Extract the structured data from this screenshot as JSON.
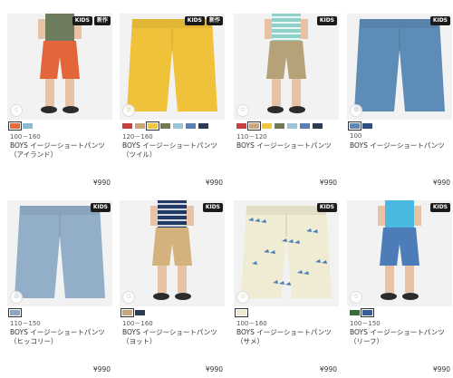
{
  "products": [
    {
      "tags": [
        "KIDS",
        "新作"
      ],
      "colors": [
        "#e46a3c",
        "#8cb9d4"
      ],
      "selected": 0,
      "size": "100－160",
      "name": "BOYS イージーショートパンツ（アイランド）",
      "price": "¥990",
      "pants_color": "#e2663a"
    },
    {
      "tags": [
        "KIDS",
        "新作"
      ],
      "colors": [
        "#c8403e",
        "#c9a77a",
        "#f1c63f",
        "#6f7a52",
        "#9ac4d8",
        "#5b7fb5",
        "#2e3b55"
      ],
      "selected": 2,
      "size": "120－160",
      "name": "BOYS イージーショートパンツ（ツイル）",
      "price": "¥990",
      "pants_color": "#f0c23a"
    },
    {
      "tags": [
        "KIDS"
      ],
      "colors": [
        "#c8403e",
        "#c9a77a",
        "#f1c63f",
        "#6f7a52",
        "#9ac4d8",
        "#5b7fb5",
        "#2e3b55"
      ],
      "selected": 1,
      "size": "110－120",
      "name": "BOYS イージーショートパンツ",
      "price": "¥990",
      "pants_color": "#b6a279"
    },
    {
      "tags": [
        "KIDS"
      ],
      "colors": [
        "#5e88b3",
        "#2f4f7a"
      ],
      "selected": 0,
      "size": "100",
      "name": "BOYS イージーショートパンツ",
      "price": "¥990",
      "pants_color": "#5d8cb6"
    },
    {
      "tags": [
        "KIDS"
      ],
      "colors": [
        "#8aa6c2"
      ],
      "selected": 0,
      "size": "110－150",
      "name": "BOYS イージーショートパンツ（ヒッコリー）",
      "price": "¥990",
      "pants_color": "#93aec9"
    },
    {
      "tags": [
        "KIDS"
      ],
      "colors": [
        "#c9a77a",
        "#2e3b55"
      ],
      "selected": 0,
      "size": "100－160",
      "name": "BOYS イージーショートパンツ（ヨット）",
      "price": "¥990",
      "pants_color": "#d3b27e"
    },
    {
      "tags": [
        "KIDS"
      ],
      "colors": [
        "#ece9d0"
      ],
      "selected": 0,
      "size": "100－160",
      "name": "BOYS イージーショートパンツ（サメ）",
      "price": "¥990",
      "pants_color": "#efecd3"
    },
    {
      "tags": [
        "KIDS"
      ],
      "colors": [
        "#3a6b3c",
        "#3b5d96"
      ],
      "selected": 1,
      "size": "100－150",
      "name": "BOYS イージーショートパンツ（リーフ）",
      "price": "¥990",
      "pants_color": "#4d7db8"
    }
  ],
  "fav_icon_text": "♡"
}
